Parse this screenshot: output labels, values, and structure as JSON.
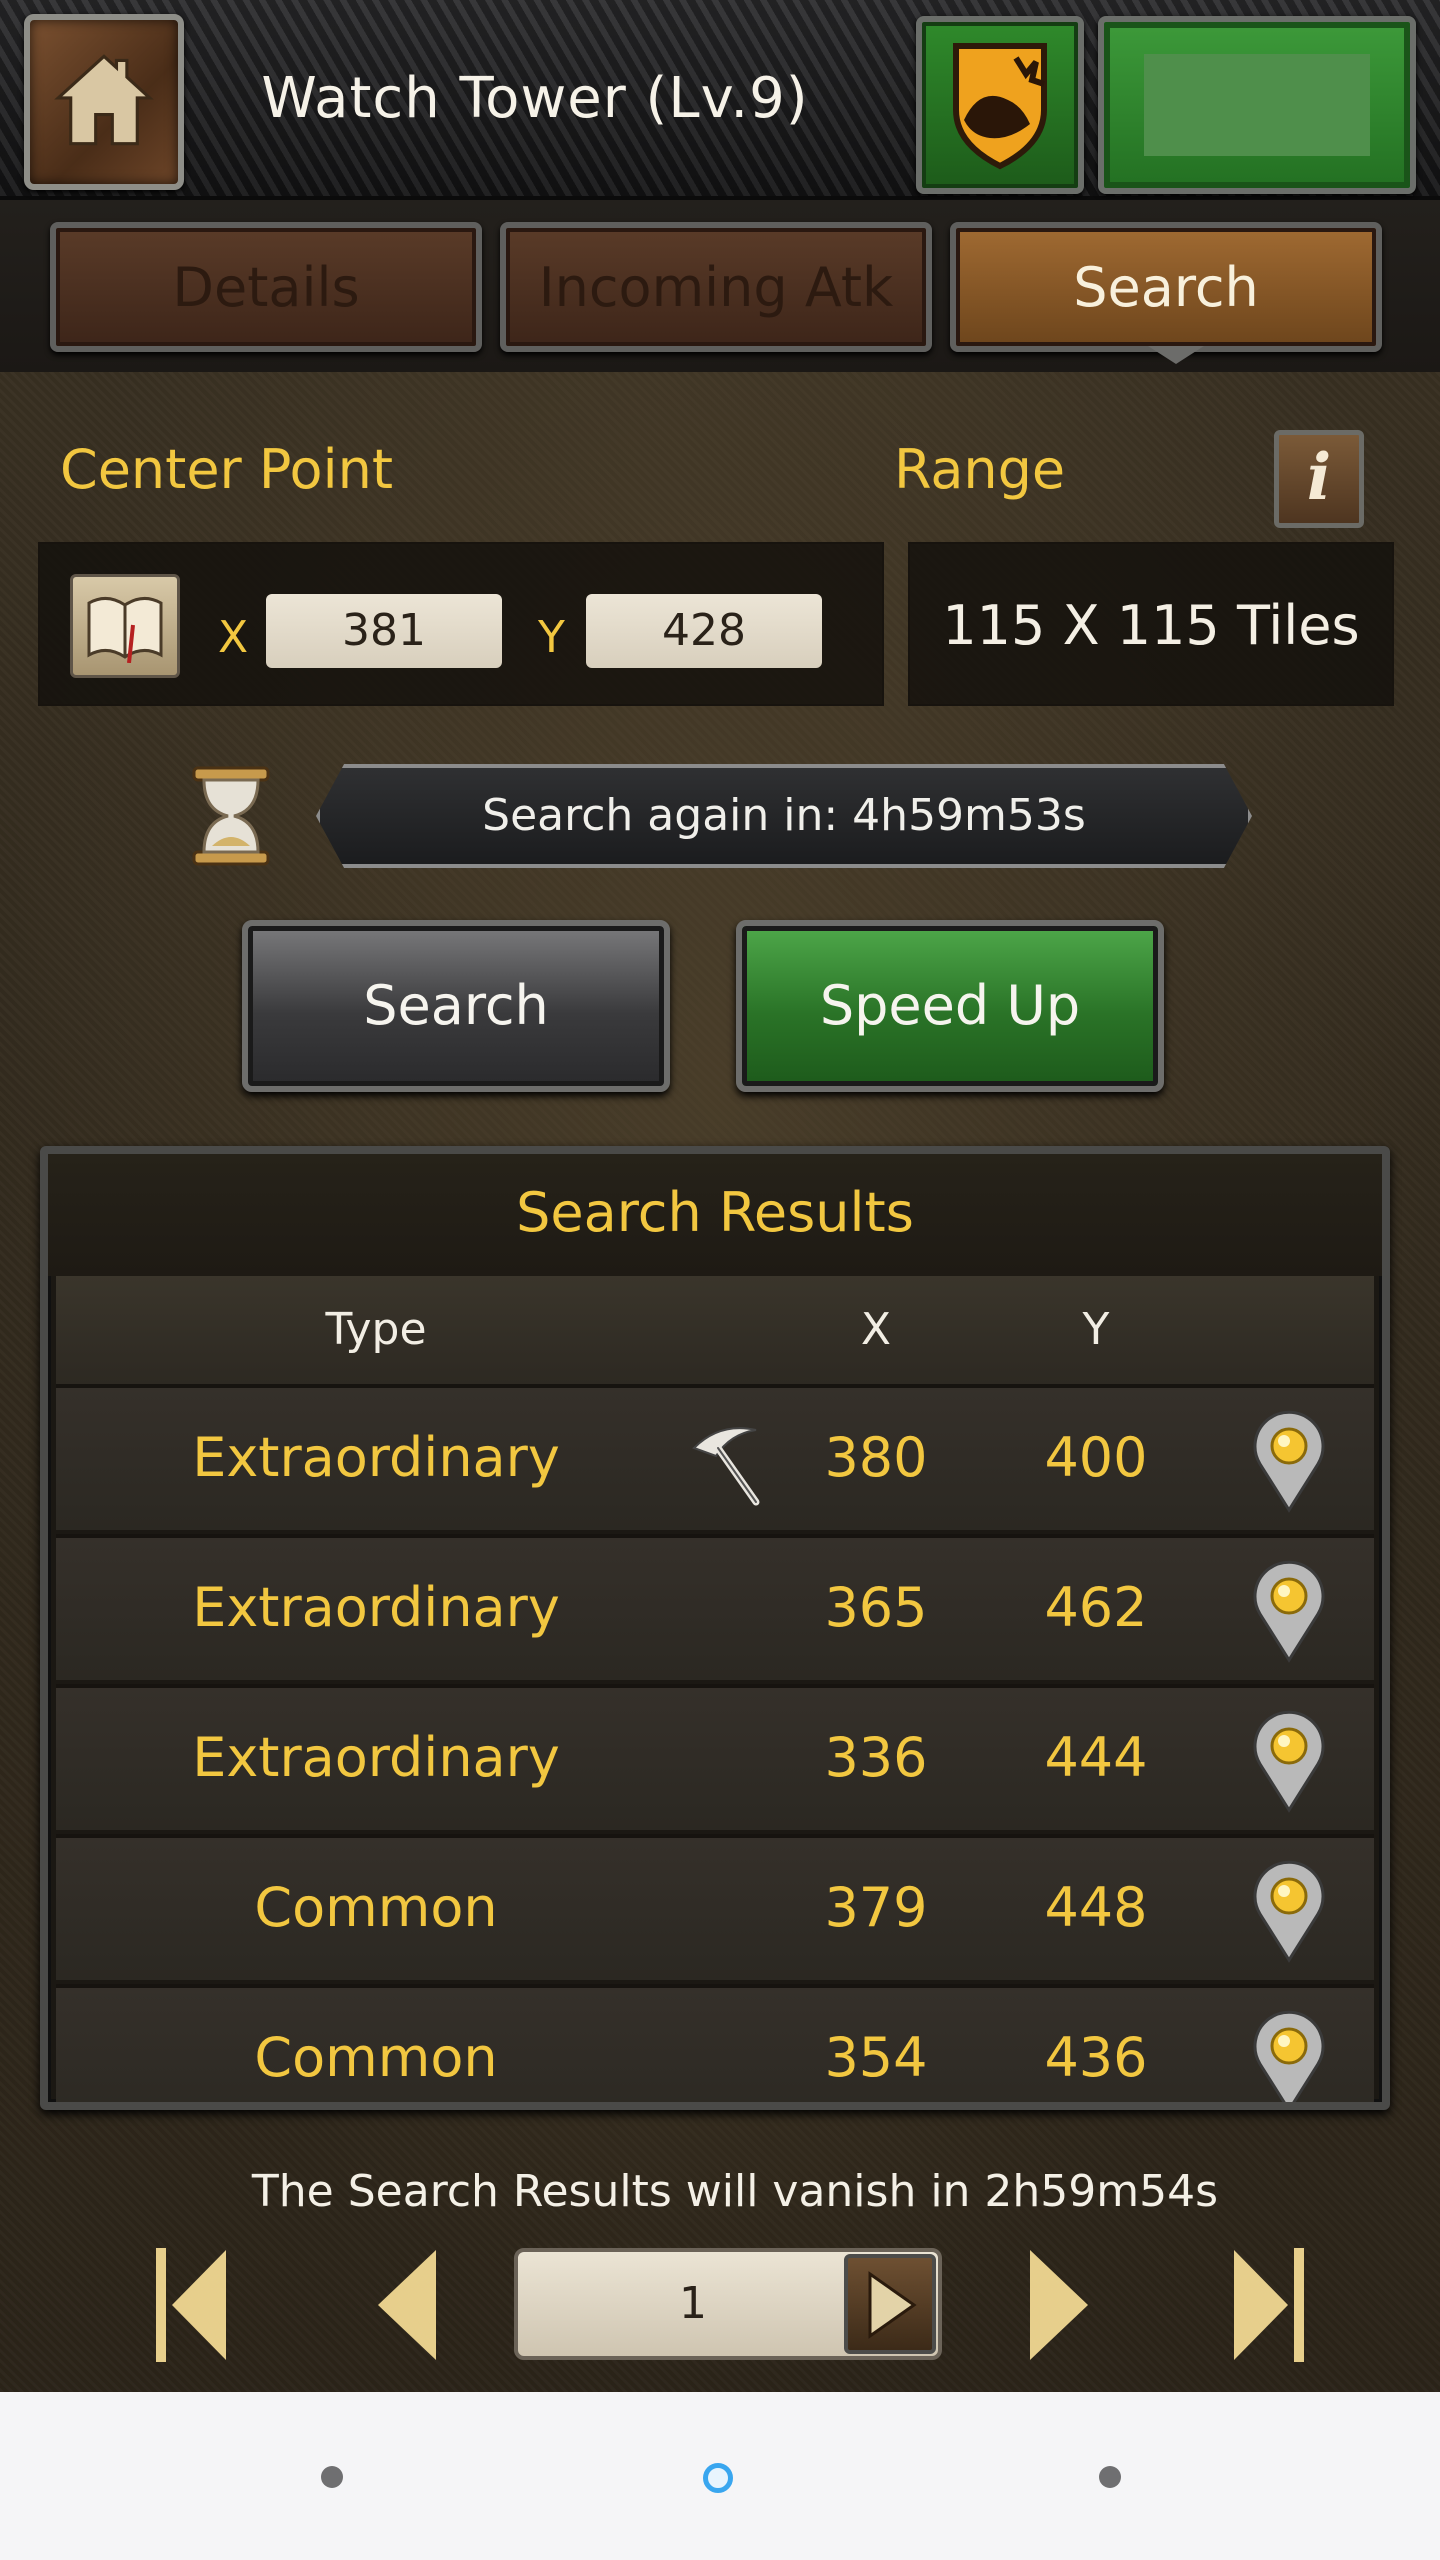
{
  "header": {
    "title": "Watch Tower (Lv.9)",
    "home_icon": "home-icon",
    "alert_icon": "shield-alert-icon"
  },
  "tabs": [
    {
      "label": "Details",
      "active": false
    },
    {
      "label": "Incoming Atk",
      "active": false
    },
    {
      "label": "Search",
      "active": true
    }
  ],
  "center_point": {
    "label": "Center Point",
    "x_label": "X",
    "y_label": "Y",
    "x": "381",
    "y": "428",
    "bookmark_icon": "book-icon"
  },
  "range": {
    "label": "Range",
    "value": "115 X 115 Tiles",
    "info_icon": "info-icon"
  },
  "timer": {
    "text": "Search again in: 4h59m53s",
    "icon": "hourglass-icon"
  },
  "actions": {
    "search_label": "Search",
    "speed_up_label": "Speed Up"
  },
  "results": {
    "title": "Search Results",
    "headers": {
      "type": "Type",
      "x": "X",
      "y": "Y"
    },
    "rows": [
      {
        "type": "Extraordinary",
        "x": "380",
        "y": "400",
        "icon": "pickaxe-icon"
      },
      {
        "type": "Extraordinary",
        "x": "365",
        "y": "462"
      },
      {
        "type": "Extraordinary",
        "x": "336",
        "y": "444"
      },
      {
        "type": "Common",
        "x": "379",
        "y": "448"
      },
      {
        "type": "Common",
        "x": "354",
        "y": "436"
      }
    ]
  },
  "footer": {
    "vanish_text": "The Search Results will vanish in 2h59m54s",
    "page": "1"
  },
  "colors": {
    "gold_text": "#f2c740",
    "tab_active": "#a06a32",
    "speed_up_green": "#2a7327"
  }
}
